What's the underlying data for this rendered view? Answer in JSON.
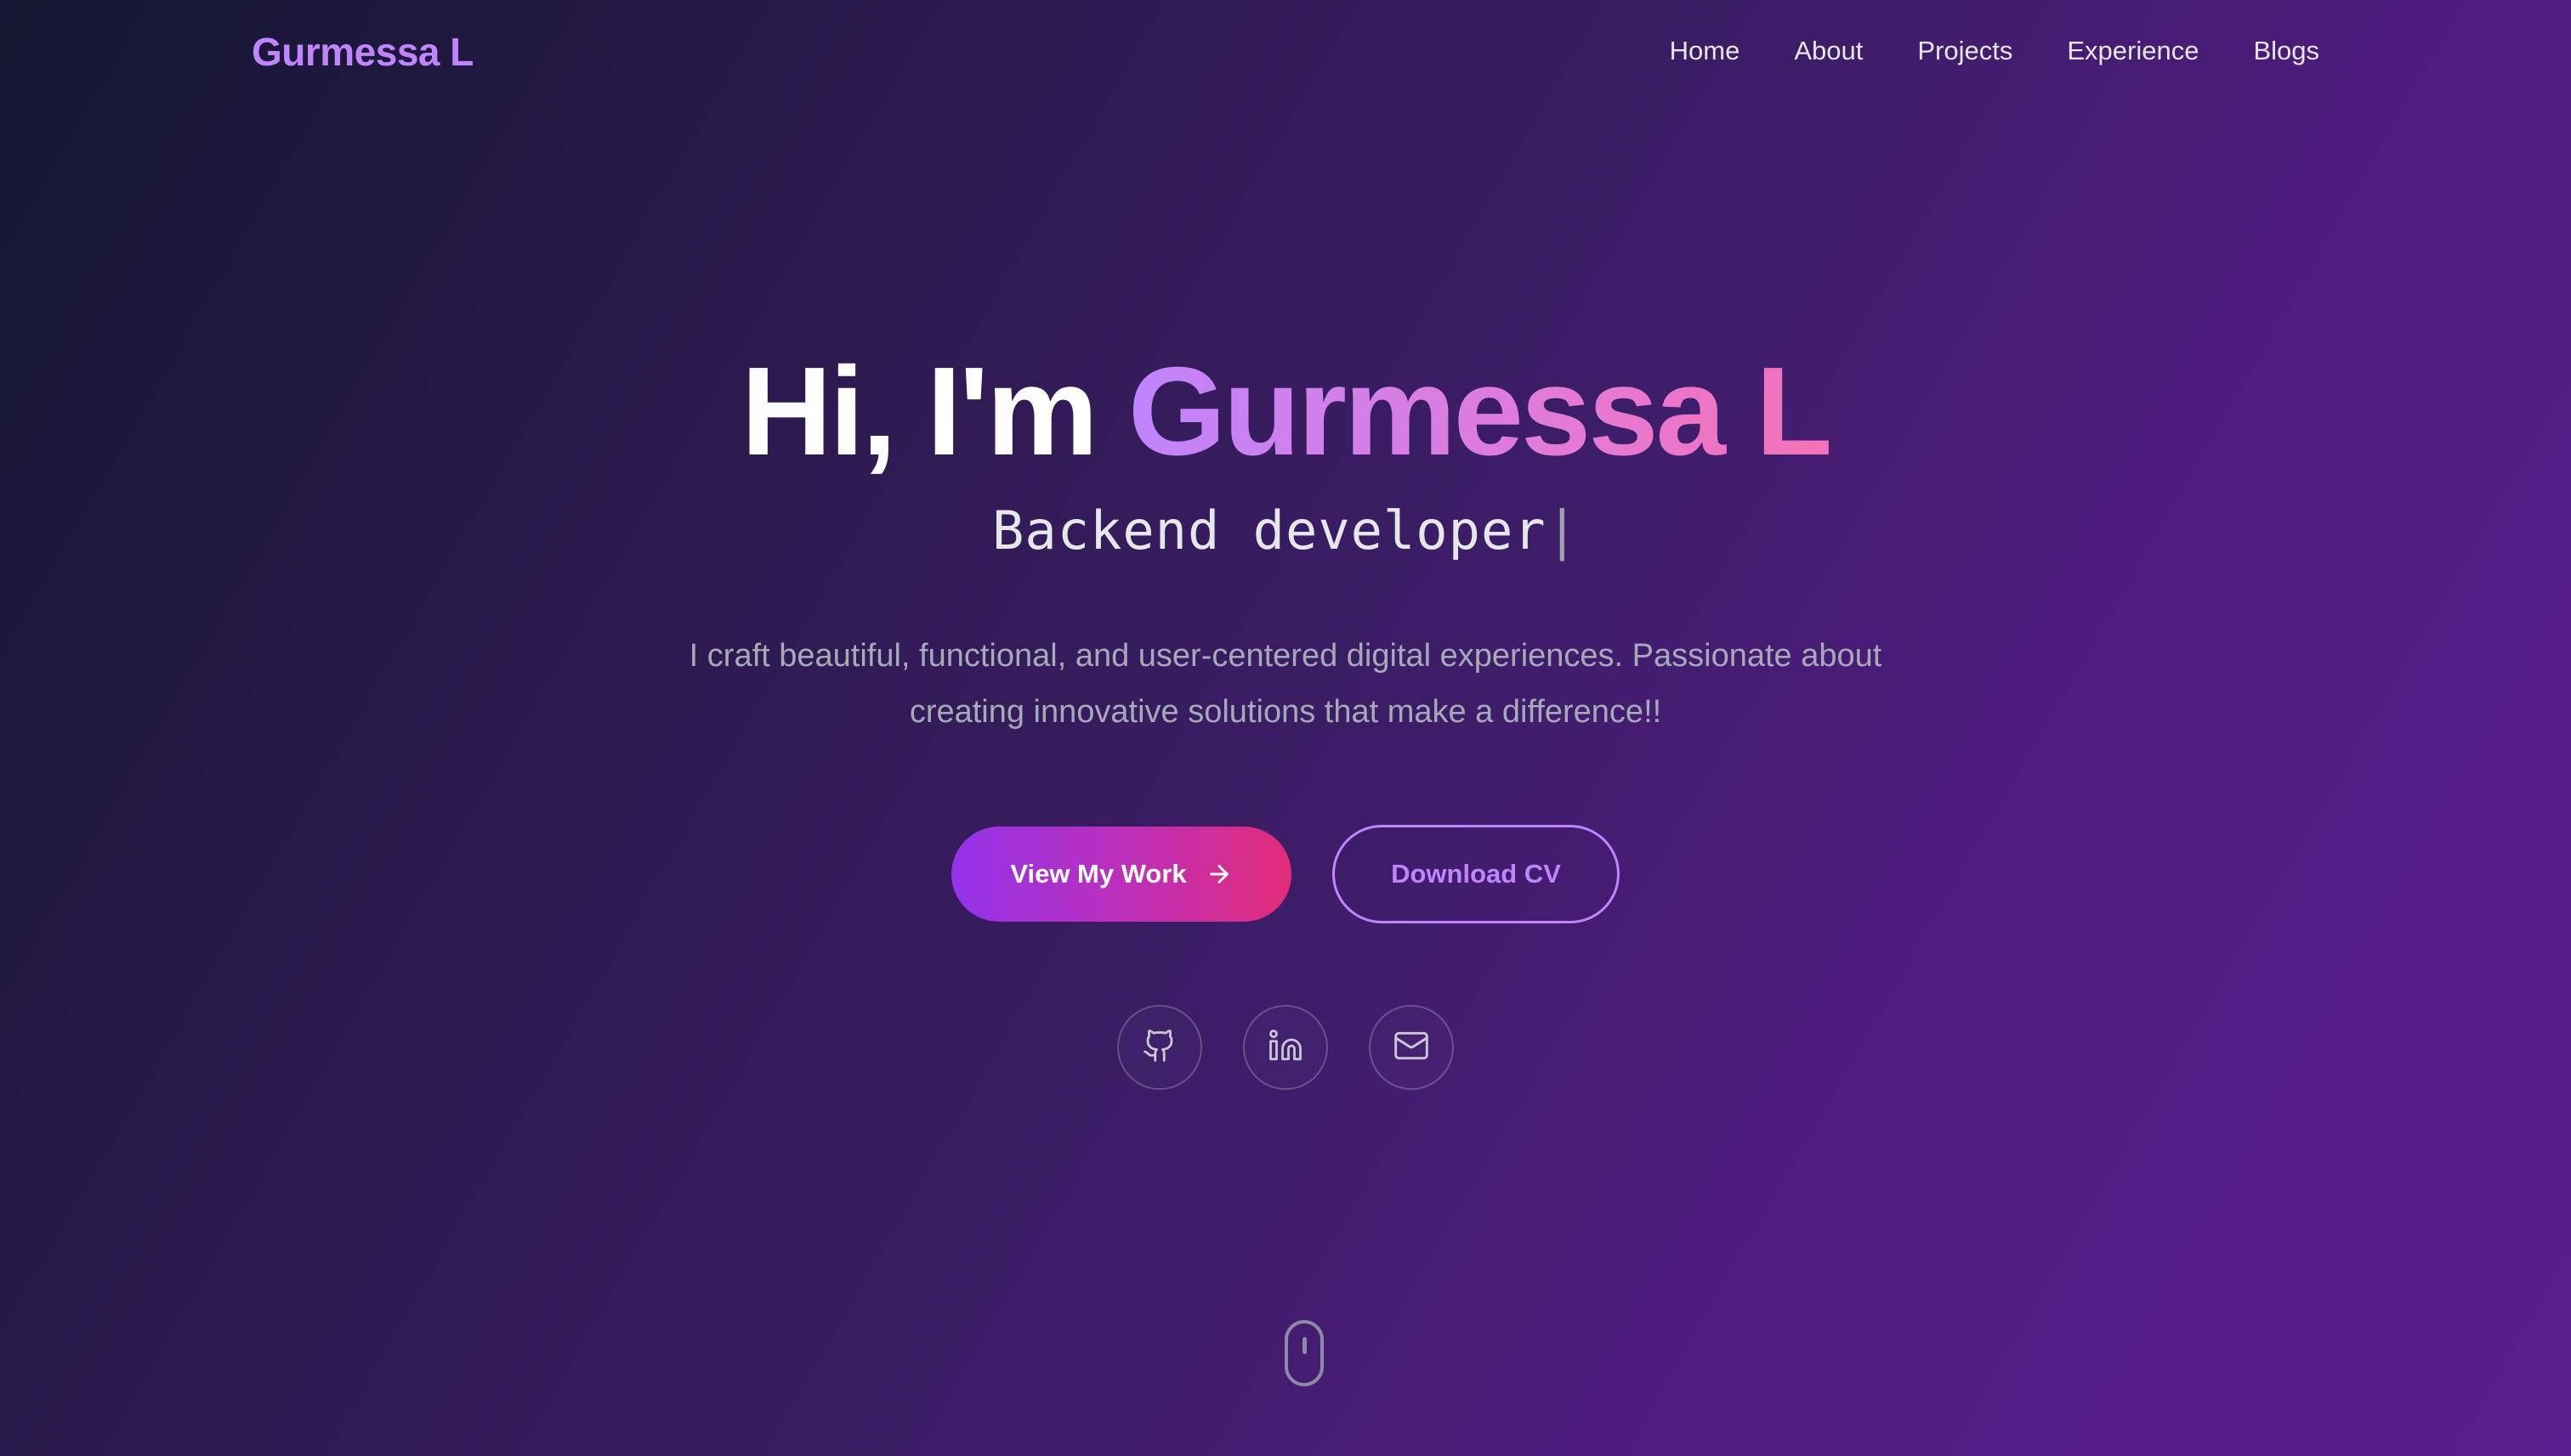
{
  "nav": {
    "logo": "Gurmessa L",
    "links": [
      {
        "label": "Home"
      },
      {
        "label": "About"
      },
      {
        "label": "Projects"
      },
      {
        "label": "Experience"
      },
      {
        "label": "Blogs"
      }
    ]
  },
  "hero": {
    "greeting": "Hi, I'm ",
    "name": "Gurmessa L",
    "role": "Backend developer",
    "cursor": "|",
    "description": "I craft beautiful, functional, and user-centered digital experiences. Passionate about creating innovative solutions that make a difference!!",
    "primary_button": "View My Work",
    "secondary_button": "Download CV"
  },
  "socials": [
    {
      "icon": "github-icon"
    },
    {
      "icon": "linkedin-icon"
    },
    {
      "icon": "mail-icon"
    }
  ],
  "scroll_indicator": {
    "icon": "mouse-scroll-icon"
  },
  "colors": {
    "accent": "#c084fc",
    "pink": "#f472b6",
    "background_dark": "#131631",
    "background_purple": "#5a1d8d"
  }
}
